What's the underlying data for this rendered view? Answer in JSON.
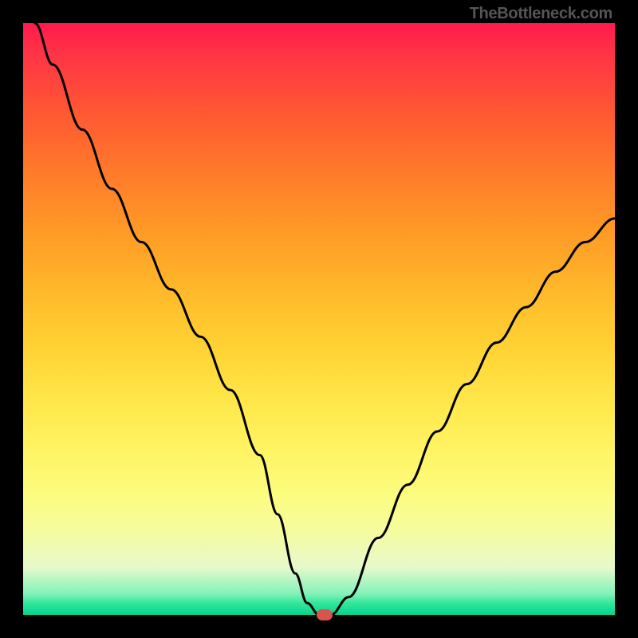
{
  "attribution": "TheBottleneck.com",
  "chart_data": {
    "type": "line",
    "title": "",
    "xlabel": "",
    "ylabel": "",
    "xlim": [
      0,
      100
    ],
    "ylim": [
      0,
      100
    ],
    "background": "gradient_red_to_green",
    "series": [
      {
        "name": "bottleneck-curve",
        "x": [
          2,
          5,
          10,
          15,
          20,
          25,
          30,
          35,
          40,
          43,
          46,
          48,
          50,
          52,
          55,
          60,
          65,
          70,
          75,
          80,
          85,
          90,
          95,
          100
        ],
        "y": [
          100,
          93,
          82,
          72,
          63,
          55,
          47,
          38,
          27,
          17,
          7,
          2,
          0,
          0,
          3,
          13,
          22,
          31,
          39,
          46,
          52,
          58,
          63,
          67
        ]
      }
    ],
    "marker": {
      "x": 51,
      "y": 0,
      "color": "#d9534f"
    }
  }
}
